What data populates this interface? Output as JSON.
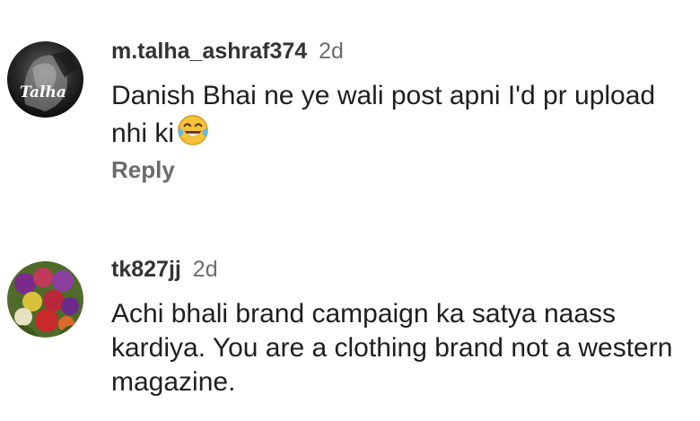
{
  "comments": [
    {
      "username": "m.talha_ashraf374",
      "time": "2d",
      "avatar_text": "Talha",
      "text": "Danish Bhai ne ye wali post apni I'd pr upload nhi ki",
      "emoji": "face-with-tears-of-joy-icon",
      "reply_label": "Reply"
    },
    {
      "username": "tk827jj",
      "time": "2d",
      "text": "Achi bhali brand campaign ka satya naass kardiya. You are a clothing brand not a western magazine."
    }
  ]
}
